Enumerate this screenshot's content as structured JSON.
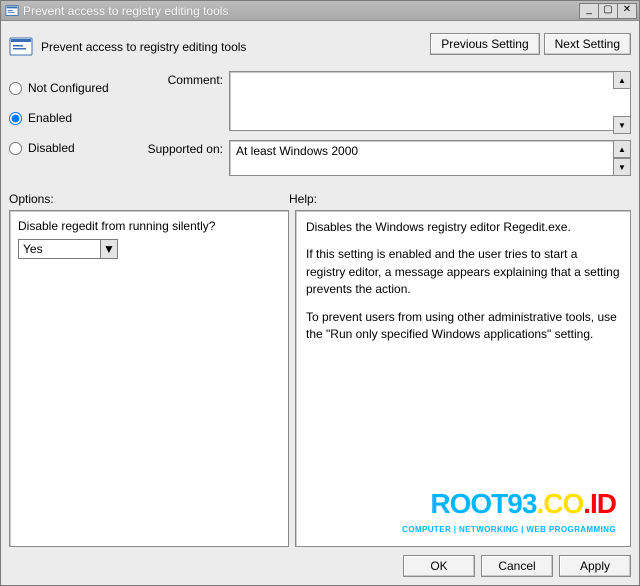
{
  "window": {
    "title": "Prevent access to registry editing tools"
  },
  "header": {
    "policy_name": "Prevent access to registry editing tools",
    "prev_label": "Previous Setting",
    "next_label": "Next Setting"
  },
  "state": {
    "not_configured_label": "Not Configured",
    "enabled_label": "Enabled",
    "disabled_label": "Disabled",
    "selected": "enabled"
  },
  "meta": {
    "comment_label": "Comment:",
    "comment_value": "",
    "supported_label": "Supported on:",
    "supported_value": "At least Windows 2000"
  },
  "sections": {
    "options_label": "Options:",
    "help_label": "Help:"
  },
  "options": {
    "disable_silent_label": "Disable regedit from running silently?",
    "disable_silent_value": "Yes"
  },
  "help": {
    "p1": "Disables the Windows registry editor Regedit.exe.",
    "p2": "If this setting is enabled and the user tries to start a registry editor, a message appears explaining that a setting prevents the action.",
    "p3": "To prevent users from using other administrative tools, use the \"Run only specified Windows applications\" setting."
  },
  "buttons": {
    "ok": "OK",
    "cancel": "Cancel",
    "apply": "Apply"
  },
  "watermark": {
    "brand": "ROOT93.CO.ID",
    "tagline": "COMPUTER | NETWORKING | WEB PROGRAMMING"
  }
}
